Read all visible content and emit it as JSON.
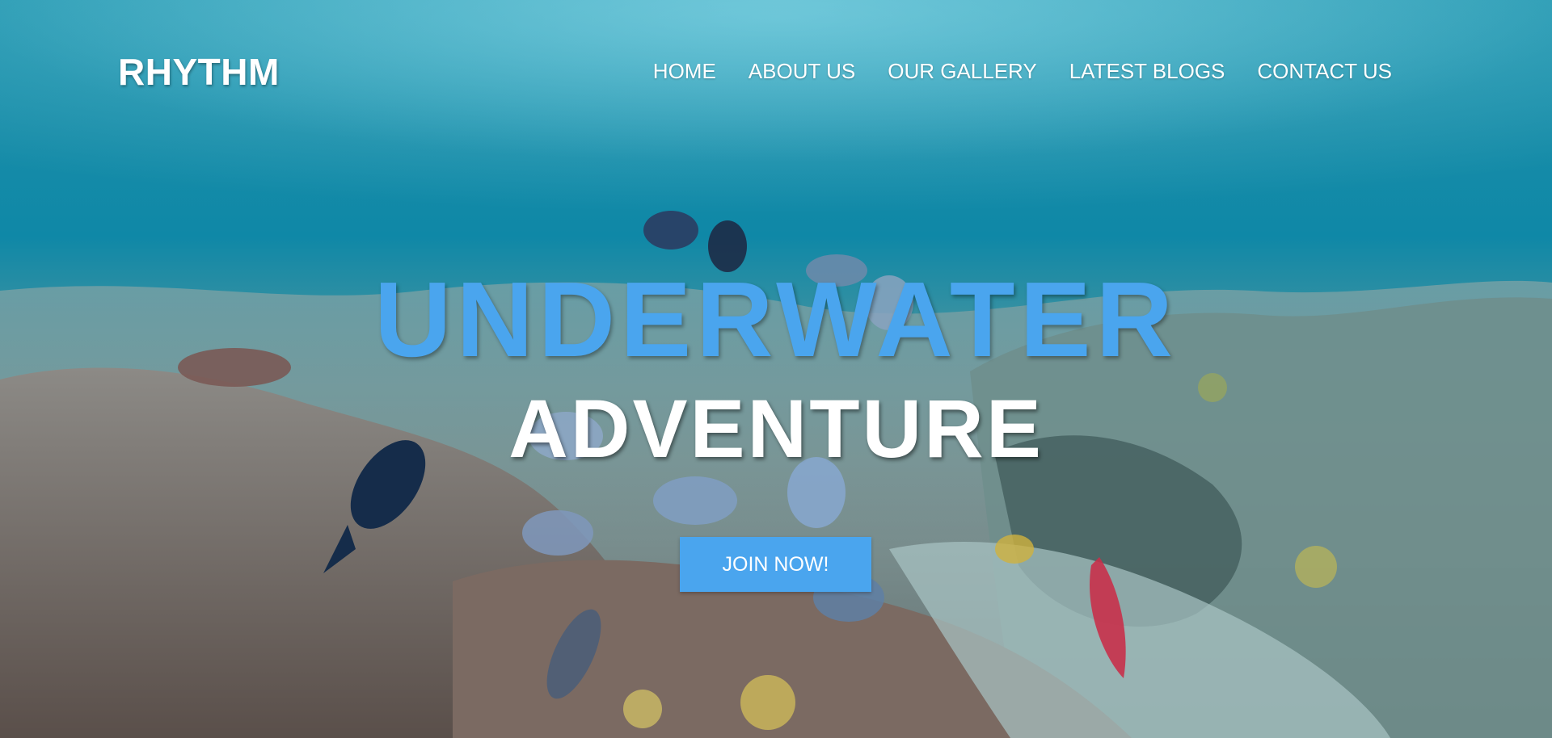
{
  "header": {
    "logo": "RHYTHM",
    "nav": [
      {
        "label": "HOME"
      },
      {
        "label": "ABOUT US"
      },
      {
        "label": "OUR GALLERY"
      },
      {
        "label": "LATEST BLOGS"
      },
      {
        "label": "CONTACT US"
      }
    ]
  },
  "hero": {
    "title_line1": "UNDERWATER",
    "title_line2": "ADVENTURE",
    "cta_label": "JOIN NOW!"
  },
  "colors": {
    "accent": "#4aa5ee",
    "text": "#ffffff",
    "water_top": "#178ca8"
  }
}
